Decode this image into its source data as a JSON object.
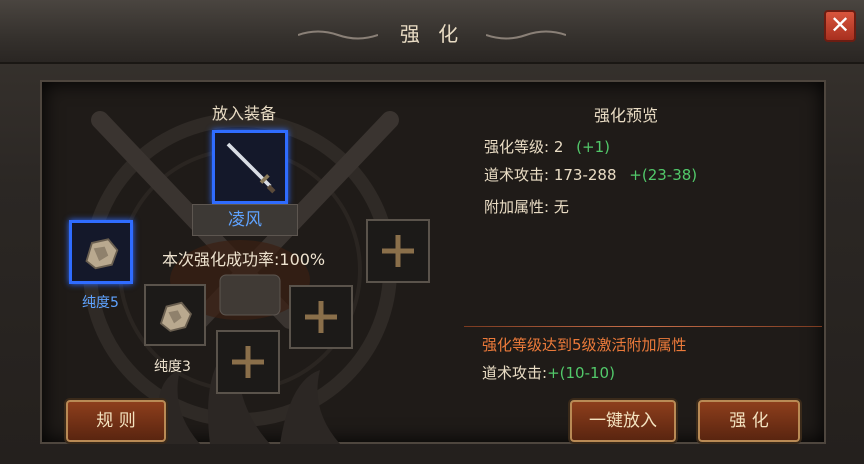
{
  "window": {
    "title": "强 化",
    "close_symbol": "✕"
  },
  "left": {
    "section_title": "放入装备",
    "equipment_name": "凌风",
    "success_rate": "本次强化成功率:100%",
    "material_1_label": "纯度5",
    "material_2_label": "纯度3",
    "plus_symbol": "+"
  },
  "preview": {
    "title": "强化预览",
    "level_label": "强化等级: 2",
    "level_delta": "(+1)",
    "attack_label": "道术攻击: 173-288",
    "attack_delta": "+(23-38)",
    "extra_label": "附加属性: 无",
    "unlock_text": "强化等级达到5级激活附加属性",
    "bonus_label": "道术攻击:",
    "bonus_value": "+(10-10)"
  },
  "buttons": {
    "rules": "规 则",
    "auto_add": "一键放入",
    "enhance": "强 化"
  },
  "colors": {
    "accent_blue": "#5fa3ff",
    "green": "#52c96a",
    "orange": "#ec7a3a",
    "button": "#8d3e1c"
  }
}
